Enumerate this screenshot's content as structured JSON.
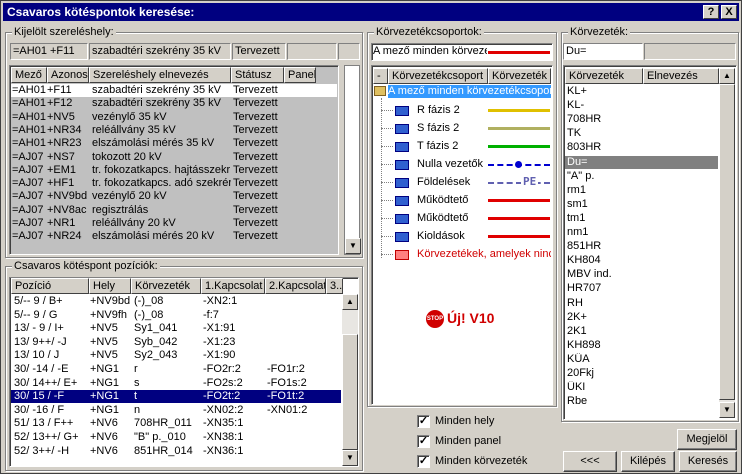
{
  "window": {
    "title": "Csavaros kötéspontok keresése:",
    "help_btn": "?",
    "close_btn": "X"
  },
  "kijelolt": {
    "label": "Kijelölt szereléshely:",
    "current": [
      "=AH01 +F11",
      "szabadtéri szekrény 35 kV",
      "Tervezett",
      "",
      ""
    ],
    "columns": [
      "Mező",
      "Azonosító",
      "Szereléshely elnevezés",
      "Státusz",
      "Panel"
    ],
    "rows": [
      [
        "=AH01",
        "+F11",
        "szabadtéri szekrény 35 kV",
        "Tervezett"
      ],
      [
        "=AH01",
        "+F12",
        "szabadtéri szekrény 35 kV",
        "Tervezett"
      ],
      [
        "=AH01",
        "+NV5",
        "vezénylő 35 kV",
        "Tervezett"
      ],
      [
        "=AH01",
        "+NR34",
        "reléállvány 35 kV",
        "Tervezett"
      ],
      [
        "=AH01",
        "+NR23",
        "elszámolási mérés 35 kV",
        "Tervezett"
      ],
      [
        "=AJ07",
        "+NS7",
        "tokozott 20 kV",
        "Tervezett"
      ],
      [
        "=AJ07",
        "+EM1",
        "tr. fokozatkapcs. hajtásszekr",
        "Tervezett"
      ],
      [
        "=AJ07",
        "+HF1",
        "tr. fokozatkapcs. adó szekrér",
        "Tervezett"
      ],
      [
        "=AJ07",
        "+NV9bd",
        "vezénylő 20 kV",
        "Tervezett"
      ],
      [
        "=AJ07",
        "+NV8ac",
        "regisztrálás",
        "Tervezett"
      ],
      [
        "=AJ07",
        "+NR1",
        "reléállvány 20 kV",
        "Tervezett"
      ],
      [
        "=AJ07",
        "+NR24",
        "elszámolási mérés 20 kV",
        "Tervezett"
      ]
    ]
  },
  "poziciok": {
    "label": "Csavaros kötéspont pozíciók:",
    "columns": [
      "Pozíció",
      "Hely",
      "Körvezeték",
      "1.Kapcsolat",
      "2.Kapcsolat",
      "3..."
    ],
    "rows": [
      [
        "5/--  9 /  B+",
        "+NV9bd",
        "(-)_08",
        "-XN2:1",
        ""
      ],
      [
        "5/--  9 /  G",
        "+NV9fh",
        "(-)_08",
        "-f:7",
        ""
      ],
      [
        "13/ - 9 /  I+",
        "+NV5",
        "Sy1_041",
        "-X1:91",
        ""
      ],
      [
        "13/  9++/ -J",
        "+NV5",
        "Syb_042",
        "-X1:23",
        ""
      ],
      [
        "13/  10 /  J",
        "+NV5",
        "Sy2_043",
        "-X1:90",
        ""
      ],
      [
        "30/ -14 / -E",
        "+NG1",
        "r",
        "-FO2r:2",
        "-FO1r:2"
      ],
      [
        "30/ 14++/ E+",
        "+NG1",
        "s",
        "-FO2s:2",
        "-FO1s:2"
      ],
      [
        "30/  15 / -F",
        "+NG1",
        "t",
        "-FO2t:2",
        "-FO1t:2"
      ],
      [
        "30/ -16 /  F",
        "+NG1",
        "n",
        "-XN02:2",
        "-XN01:2"
      ],
      [
        "51/  13 / F++",
        "+NV6",
        "708HR_011",
        "-XN35:1",
        ""
      ],
      [
        "52/ 13++/ G+",
        "+NV6",
        "\"B\" p._010",
        "-XN38:1",
        ""
      ],
      [
        "52/  3++/ -H",
        "+NV6",
        "851HR_014",
        "-XN36:1",
        ""
      ]
    ],
    "selected_row": 7
  },
  "csoportok": {
    "label": "Körvezetékcsoportok:",
    "field": "A mező minden körveze",
    "columns": [
      "-",
      "Körvezetékcsoport",
      "Körvezeték"
    ],
    "root": "A mező minden körvezetékcsoport",
    "items": [
      {
        "label": "R fázis 2",
        "line_color": "#e0c000"
      },
      {
        "label": "S fázis 2",
        "line_color": "#b0b060"
      },
      {
        "label": "T fázis 2",
        "line_color": "#00b000"
      },
      {
        "label": "Nulla vezetők",
        "line_color": "#0000d0"
      },
      {
        "label": "Földelések",
        "line_color": "#6060b0",
        "pe_label": "PE"
      },
      {
        "label": "Működtető",
        "line_color": "#e00000"
      },
      {
        "label": "Működtető",
        "line_color": "#e00000"
      },
      {
        "label": "Kioldások",
        "line_color": "#e00000"
      },
      {
        "label": "Körvezetékek, amelyek ninc",
        "line_color": "",
        "is_red": true
      }
    ],
    "badge": "Új! V10",
    "stop_text": "STOP"
  },
  "korvezetek": {
    "label": "Körvezeték:",
    "field1": "Du=",
    "field2": "",
    "columns": [
      "Körvezeték",
      "Elnevezés"
    ],
    "items": [
      "KL+",
      "KL-",
      "708HR",
      "TK",
      "803HR",
      "Du=",
      "\"A\" p.",
      "rm1",
      "sm1",
      "tm1",
      "nm1",
      "851HR",
      "KH804",
      "MBV ind.",
      "HR707",
      "RH",
      "2K+",
      "2K1",
      "KH898",
      "KÜA",
      "20Fkj",
      "ÜKI",
      "Rbe"
    ],
    "selected": 5
  },
  "checks": [
    {
      "label": "Minden hely",
      "checked": "✓"
    },
    {
      "label": "Minden panel",
      "checked": "✓"
    },
    {
      "label": "Minden körvezeték",
      "checked": "✓"
    }
  ],
  "buttons": {
    "megjelol": "Megjelöl",
    "back": "<<<",
    "kilepes": "Kilépés",
    "kereses": "Keresés"
  }
}
